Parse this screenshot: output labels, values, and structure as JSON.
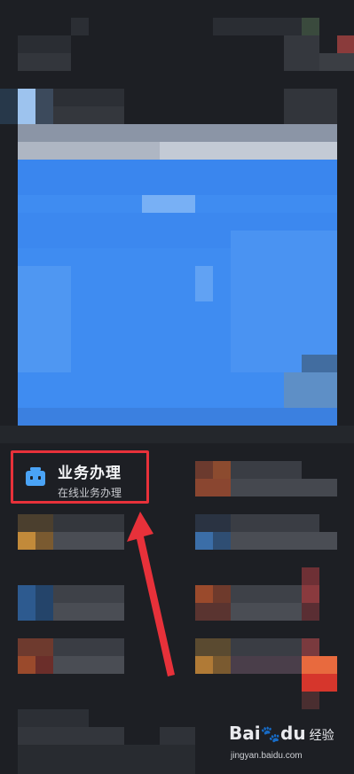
{
  "service_item": {
    "title": "业务办理",
    "subtitle": "在线业务办理",
    "icon": "briefcase-robot-icon"
  },
  "watermark": {
    "logo_text": "Bai",
    "logo_mark": "du",
    "logo_suffix": "经验",
    "url": "jingyan.baidu.com"
  },
  "colors": {
    "background": "#1d1f24",
    "accent_blue": "#3f8cf1",
    "highlight_red": "#e7313a",
    "icon_blue": "#4aa3f6"
  }
}
